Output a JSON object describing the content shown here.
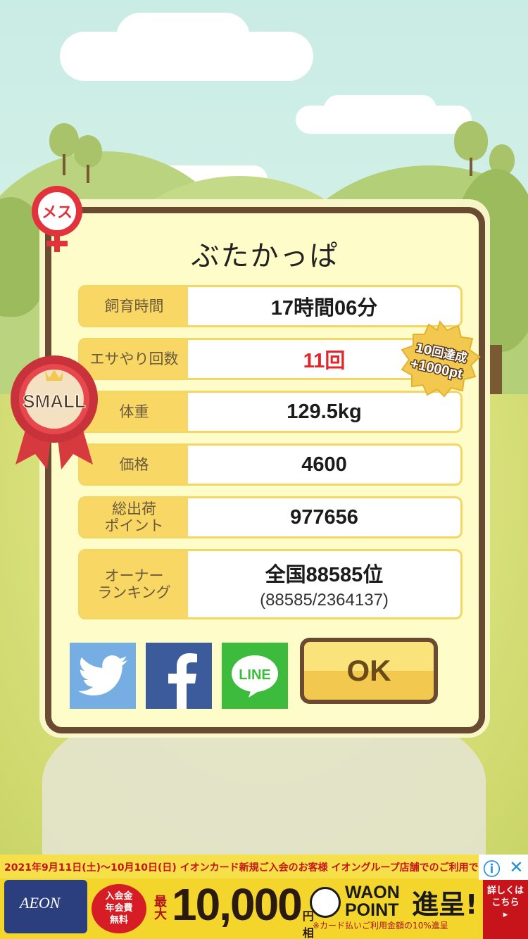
{
  "pig": {
    "name": "ぶたかっぱ",
    "gender_badge": "メス",
    "size_badge": "SMALL"
  },
  "stats": [
    {
      "label": "飼育時間",
      "value": "17時間06分"
    },
    {
      "label": "エサやり回数",
      "value": "11回"
    },
    {
      "label": "体重",
      "value": "129.5kg"
    },
    {
      "label": "価格",
      "value": "4600"
    },
    {
      "label": "総出荷\nポイント",
      "value": "977656"
    },
    {
      "label": "オーナー\nランキング",
      "value": "全国88585位",
      "sub": "(88585/2364137)"
    }
  ],
  "achievement": {
    "line1": "10回達成",
    "line2": "+1000pt"
  },
  "buttons": {
    "twitter": "twitter-share",
    "facebook": "facebook-share",
    "line": "LINE",
    "ok": "OK"
  },
  "colors": {
    "twitter": "#76aee3",
    "facebook": "#3b5b9a",
    "line": "#3dbb3c",
    "frame": "#6a4a30",
    "label_bg": "#f8d765",
    "highlight": "#e0262a"
  },
  "ad": {
    "headline": "2021年9月11日(土)～10月10日(日) イオンカード新規ご入会のお客様 イオングループ店舗でのご利用で",
    "card_brand": "AEON",
    "circle_text": "入会金\n年会費\n無料",
    "amount_prefix": "最大",
    "amount": "10,000",
    "amount_unit": "円相当",
    "waon": "WAON\nPOINT",
    "gift": "進呈!",
    "note": "※カード払いご利用金額の10%進呈",
    "side_text": "詳しくは\nこちら\n▸",
    "info_icon": "ⓘ",
    "close_icon": "✕"
  }
}
